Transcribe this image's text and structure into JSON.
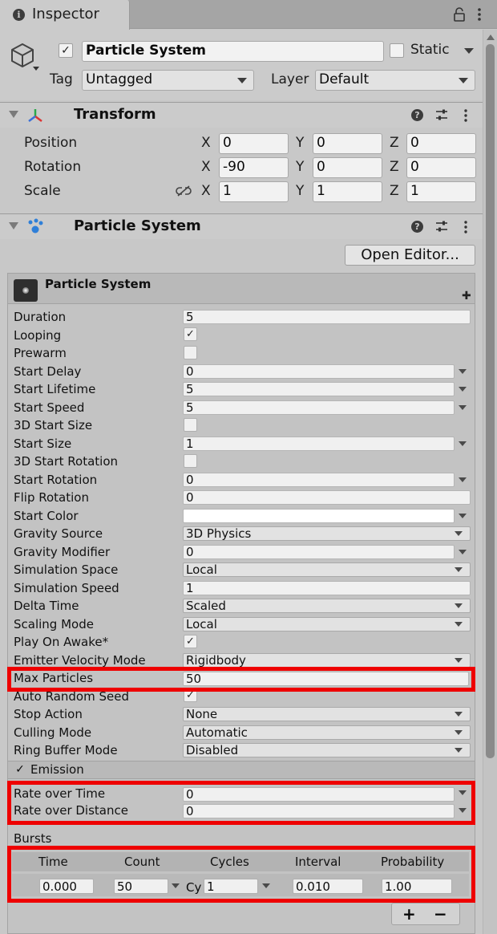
{
  "tab": {
    "title": "Inspector"
  },
  "header": {
    "enabled": true,
    "name": "Particle System",
    "static_label": "Static",
    "tag_label": "Tag",
    "tag_value": "Untagged",
    "layer_label": "Layer",
    "layer_value": "Default"
  },
  "transform": {
    "title": "Transform",
    "position": {
      "label": "Position",
      "x": "0",
      "y": "0",
      "z": "0"
    },
    "rotation": {
      "label": "Rotation",
      "x": "-90",
      "y": "0",
      "z": "0"
    },
    "scale": {
      "label": "Scale",
      "x": "1",
      "y": "1",
      "z": "1"
    },
    "axes": {
      "x": "X",
      "y": "Y",
      "z": "Z"
    }
  },
  "particle_component": {
    "title": "Particle System",
    "open_editor": "Open Editor...",
    "main_module_title": "Particle System"
  },
  "main": {
    "duration": {
      "label": "Duration",
      "value": "5"
    },
    "looping": {
      "label": "Looping",
      "value": "✓"
    },
    "prewarm": {
      "label": "Prewarm",
      "value": ""
    },
    "start_delay": {
      "label": "Start Delay",
      "value": "0"
    },
    "start_lifetime": {
      "label": "Start Lifetime",
      "value": "5"
    },
    "start_speed": {
      "label": "Start Speed",
      "value": "5"
    },
    "start_size_3d": {
      "label": "3D Start Size",
      "value": ""
    },
    "start_size": {
      "label": "Start Size",
      "value": "1"
    },
    "start_rotation_3d": {
      "label": "3D Start Rotation",
      "value": ""
    },
    "start_rotation": {
      "label": "Start Rotation",
      "value": "0"
    },
    "flip_rotation": {
      "label": "Flip Rotation",
      "value": "0"
    },
    "start_color": {
      "label": "Start Color",
      "color": "#ffffff"
    },
    "gravity_source": {
      "label": "Gravity Source",
      "value": "3D Physics"
    },
    "gravity_modifier": {
      "label": "Gravity Modifier",
      "value": "0"
    },
    "simulation_space": {
      "label": "Simulation Space",
      "value": "Local"
    },
    "simulation_speed": {
      "label": "Simulation Speed",
      "value": "1"
    },
    "delta_time": {
      "label": "Delta Time",
      "value": "Scaled"
    },
    "scaling_mode": {
      "label": "Scaling Mode",
      "value": "Local"
    },
    "play_on_awake": {
      "label": "Play On Awake*",
      "value": "✓"
    },
    "emitter_velocity_mode": {
      "label": "Emitter Velocity Mode",
      "value": "Rigidbody"
    },
    "max_particles": {
      "label": "Max Particles",
      "value": "50"
    },
    "auto_random_seed": {
      "label": "Auto Random Seed",
      "value": "✓"
    },
    "stop_action": {
      "label": "Stop Action",
      "value": "None"
    },
    "culling_mode": {
      "label": "Culling Mode",
      "value": "Automatic"
    },
    "ring_buffer_mode": {
      "label": "Ring Buffer Mode",
      "value": "Disabled"
    }
  },
  "emission": {
    "title": "Emission",
    "enabled": "✓",
    "rate_over_time": {
      "label": "Rate over Time",
      "value": "0"
    },
    "rate_over_distance": {
      "label": "Rate over Distance",
      "value": "0"
    },
    "bursts_label": "Bursts",
    "bursts_columns": [
      "Time",
      "Count",
      "Cycles",
      "Interval",
      "Probability"
    ],
    "bursts_rows": [
      {
        "time": "0.000",
        "count": "50",
        "cycles_prefix": "Cy",
        "cycles": "1",
        "interval": "0.010",
        "probability": "1.00"
      }
    ],
    "add": "+",
    "remove": "−"
  },
  "colors": {
    "highlight": "#ee0000",
    "panel": "#c3c3c3"
  }
}
